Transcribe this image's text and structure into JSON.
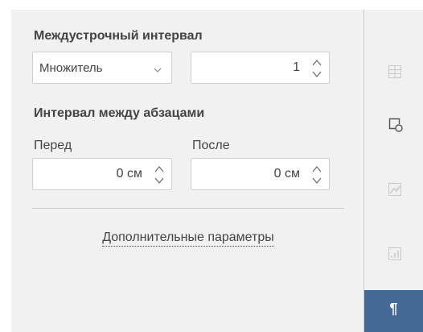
{
  "line_spacing": {
    "title": "Междустрочный интервал",
    "mode": "Множитель",
    "value": "1"
  },
  "paragraph_spacing": {
    "title": "Интервал между абзацами",
    "before_label": "Перед",
    "before_value": "0 см",
    "after_label": "После",
    "after_value": "0 см"
  },
  "advanced_link": "Дополнительные параметры",
  "right_toolbar": {
    "icons": [
      "table-settings-icon",
      "shape-settings-icon",
      "image-settings-icon",
      "chart-settings-icon",
      "paragraph-settings-icon"
    ],
    "active": "paragraph-settings-icon",
    "paragraph_glyph": "¶",
    "active_color": "#446995"
  }
}
